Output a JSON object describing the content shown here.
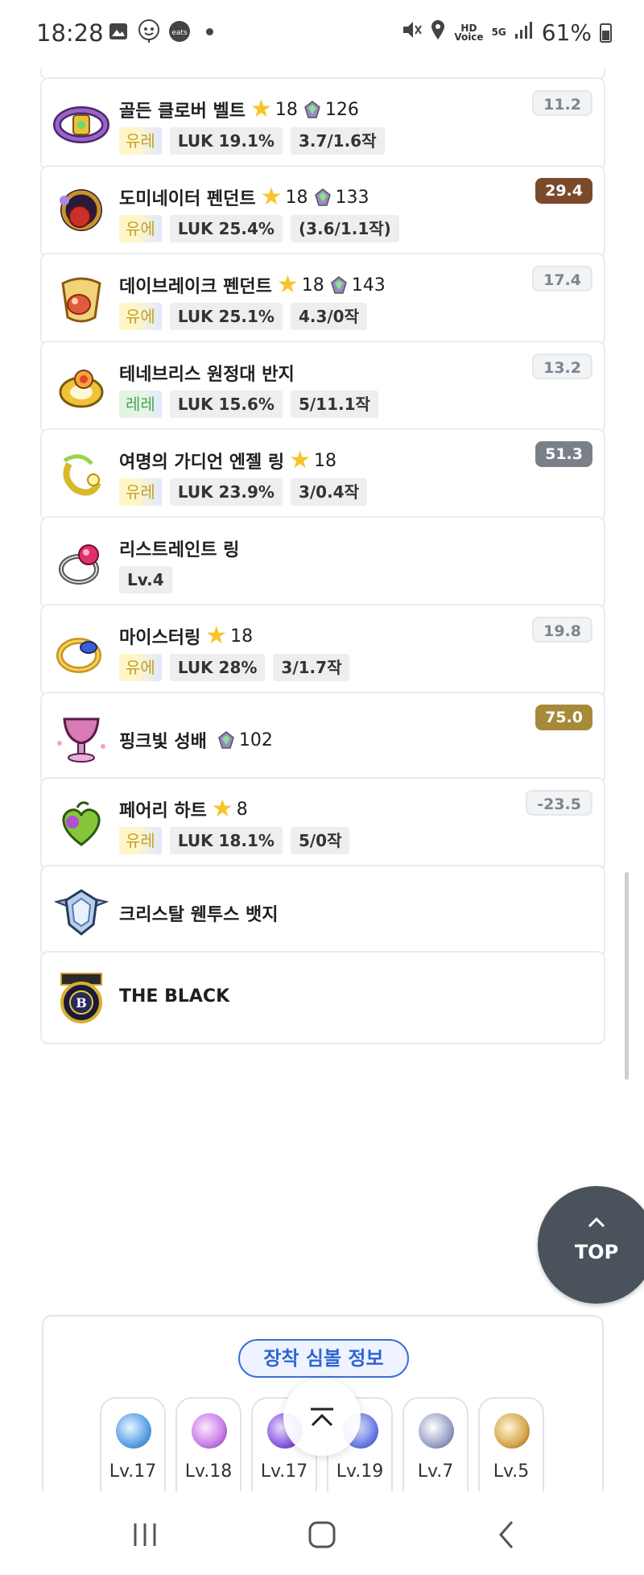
{
  "status_bar": {
    "time": "18:28",
    "battery": "61%",
    "hd_label": "HD\nVoice",
    "net_label": "5G",
    "icons": [
      "gallery-icon",
      "coupang-eats-icon",
      "mute-icon",
      "location-icon",
      "signal-icon",
      "battery-icon"
    ]
  },
  "items": [
    {
      "name": "골든 클로버 벨트",
      "star": "18",
      "gem": "126",
      "potential": "유레",
      "potential_type": "unique",
      "stat": "LUK 19.1%",
      "scroll": "3.7/1.6작",
      "score": "11.2",
      "score_style": "light",
      "icon": "belt-icon"
    },
    {
      "name": "도미네이터 펜던트",
      "star": "18",
      "gem": "133",
      "potential": "유에",
      "potential_type": "unique",
      "stat": "LUK 25.4%",
      "scroll": "(3.6/1.1작)",
      "score": "29.4",
      "score_style": "brown",
      "icon": "pendant-icon"
    },
    {
      "name": "데이브레이크 펜던트",
      "star": "18",
      "gem": "143",
      "potential": "유에",
      "potential_type": "unique",
      "stat": "LUK 25.1%",
      "scroll": "4.3/0작",
      "score": "17.4",
      "score_style": "light",
      "icon": "pendant-icon"
    },
    {
      "name": "테네브리스 원정대 반지",
      "potential": "레레",
      "potential_type": "legend",
      "stat": "LUK 15.6%",
      "scroll": "5/11.1작",
      "score": "13.2",
      "score_style": "light",
      "icon": "ring-icon"
    },
    {
      "name": "여명의 가디언 엔젤 링",
      "star": "18",
      "potential": "유레",
      "potential_type": "unique",
      "stat": "LUK 23.9%",
      "scroll": "3/0.4작",
      "score": "51.3",
      "score_style": "gray",
      "icon": "ring-icon"
    },
    {
      "name": "리스트레인트 링",
      "level": "Lv.4",
      "icon": "ring-icon"
    },
    {
      "name": "마이스터링",
      "star": "18",
      "potential": "유에",
      "potential_type": "unique",
      "stat": "LUK 28%",
      "scroll": "3/1.7작",
      "score": "19.8",
      "score_style": "light",
      "icon": "ring-icon"
    },
    {
      "name": "핑크빛 성배",
      "gem": "102",
      "score": "75.0",
      "score_style": "gold",
      "icon": "chalice-icon"
    },
    {
      "name": "페어리 하트",
      "star": "8",
      "potential": "유레",
      "potential_type": "unique",
      "stat": "LUK 18.1%",
      "scroll": "5/0작",
      "score": "-23.5",
      "score_style": "light",
      "icon": "heart-icon"
    },
    {
      "name": "크리스탈 웬투스 뱃지",
      "icon": "badge-icon"
    },
    {
      "name": "THE BLACK",
      "icon": "medal-icon"
    }
  ],
  "top_button": {
    "label": "TOP"
  },
  "symbols": {
    "title": "장착 심볼 정보",
    "items": [
      {
        "level": "Lv.17",
        "color": "#5aa0e6"
      },
      {
        "level": "Lv.18",
        "color": "#c77ee8"
      },
      {
        "level": "Lv.17",
        "color": "#8b5be0"
      },
      {
        "level": "Lv.19",
        "color": "#6d7fe8"
      },
      {
        "level": "Lv.7",
        "color": "#9aa3c8"
      },
      {
        "level": "Lv.5",
        "color": "#d6a84e"
      }
    ]
  },
  "colors": {
    "accent": "#3b6fd8",
    "star": "#f7c52b",
    "top_button": "#4a535c"
  }
}
